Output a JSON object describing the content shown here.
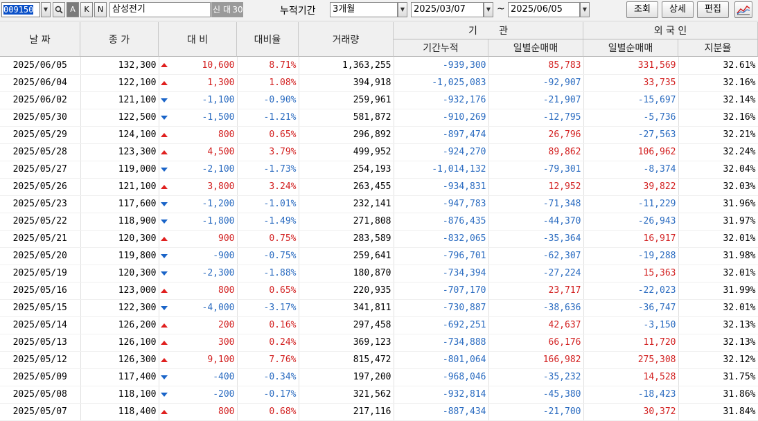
{
  "toolbar": {
    "code": "009150",
    "btn_a": "A",
    "btn_k": "K",
    "btn_n": "N",
    "stock_name": "삼성전기",
    "tag_new": "신",
    "tag_loan": "대",
    "tag_30": "30",
    "period_label": "누적기간",
    "period_value": "3개월",
    "date_from": "2025/03/07",
    "tilde": "~",
    "date_to": "2025/06/05",
    "btn_query": "조회",
    "btn_detail": "상세",
    "btn_edit": "편집"
  },
  "headers": {
    "date": "날 짜",
    "close": "종 가",
    "change": "대 비",
    "change_rate": "대비율",
    "volume": "거래량",
    "inst": "기       관",
    "inst_cum": "기간누적",
    "inst_daily": "일별순매매",
    "foreign": "외 국 인",
    "foreign_daily": "일별순매매",
    "foreign_share": "지분율"
  },
  "colors": {
    "up": "#d21f1f",
    "down": "#2a6bc0"
  },
  "rows": [
    {
      "date": "2025/06/05",
      "close": "132,300",
      "dir": "up",
      "change": "10,600",
      "rate": "8.71%",
      "volume": "1,363,255",
      "inst_cum": "-939,300",
      "inst_daily": "85,783",
      "for_daily": "331,569",
      "share": "32.61%"
    },
    {
      "date": "2025/06/04",
      "close": "122,100",
      "dir": "up",
      "change": "1,300",
      "rate": "1.08%",
      "volume": "394,918",
      "inst_cum": "-1,025,083",
      "inst_daily": "-92,907",
      "for_daily": "33,735",
      "share": "32.16%"
    },
    {
      "date": "2025/06/02",
      "close": "121,100",
      "dir": "down",
      "change": "-1,100",
      "rate": "-0.90%",
      "volume": "259,961",
      "inst_cum": "-932,176",
      "inst_daily": "-21,907",
      "for_daily": "-15,697",
      "share": "32.14%"
    },
    {
      "date": "2025/05/30",
      "close": "122,500",
      "dir": "down",
      "change": "-1,500",
      "rate": "-1.21%",
      "volume": "581,872",
      "inst_cum": "-910,269",
      "inst_daily": "-12,795",
      "for_daily": "-5,736",
      "share": "32.16%"
    },
    {
      "date": "2025/05/29",
      "close": "124,100",
      "dir": "up",
      "change": "800",
      "rate": "0.65%",
      "volume": "296,892",
      "inst_cum": "-897,474",
      "inst_daily": "26,796",
      "for_daily": "-27,563",
      "share": "32.21%"
    },
    {
      "date": "2025/05/28",
      "close": "123,300",
      "dir": "up",
      "change": "4,500",
      "rate": "3.79%",
      "volume": "499,952",
      "inst_cum": "-924,270",
      "inst_daily": "89,862",
      "for_daily": "106,962",
      "share": "32.24%"
    },
    {
      "date": "2025/05/27",
      "close": "119,000",
      "dir": "down",
      "change": "-2,100",
      "rate": "-1.73%",
      "volume": "254,193",
      "inst_cum": "-1,014,132",
      "inst_daily": "-79,301",
      "for_daily": "-8,374",
      "share": "32.04%"
    },
    {
      "date": "2025/05/26",
      "close": "121,100",
      "dir": "up",
      "change": "3,800",
      "rate": "3.24%",
      "volume": "263,455",
      "inst_cum": "-934,831",
      "inst_daily": "12,952",
      "for_daily": "39,822",
      "share": "32.03%"
    },
    {
      "date": "2025/05/23",
      "close": "117,600",
      "dir": "down",
      "change": "-1,200",
      "rate": "-1.01%",
      "volume": "232,141",
      "inst_cum": "-947,783",
      "inst_daily": "-71,348",
      "for_daily": "-11,229",
      "share": "31.96%"
    },
    {
      "date": "2025/05/22",
      "close": "118,900",
      "dir": "down",
      "change": "-1,800",
      "rate": "-1.49%",
      "volume": "271,808",
      "inst_cum": "-876,435",
      "inst_daily": "-44,370",
      "for_daily": "-26,943",
      "share": "31.97%"
    },
    {
      "date": "2025/05/21",
      "close": "120,300",
      "dir": "up",
      "change": "900",
      "rate": "0.75%",
      "volume": "283,589",
      "inst_cum": "-832,065",
      "inst_daily": "-35,364",
      "for_daily": "16,917",
      "share": "32.01%"
    },
    {
      "date": "2025/05/20",
      "close": "119,800",
      "dir": "down",
      "change": "-900",
      "rate": "-0.75%",
      "volume": "259,641",
      "inst_cum": "-796,701",
      "inst_daily": "-62,307",
      "for_daily": "-19,288",
      "share": "31.98%"
    },
    {
      "date": "2025/05/19",
      "close": "120,300",
      "dir": "down",
      "change": "-2,300",
      "rate": "-1.88%",
      "volume": "180,870",
      "inst_cum": "-734,394",
      "inst_daily": "-27,224",
      "for_daily": "15,363",
      "share": "32.01%"
    },
    {
      "date": "2025/05/16",
      "close": "123,000",
      "dir": "up",
      "change": "800",
      "rate": "0.65%",
      "volume": "220,935",
      "inst_cum": "-707,170",
      "inst_daily": "23,717",
      "for_daily": "-22,023",
      "share": "31.99%"
    },
    {
      "date": "2025/05/15",
      "close": "122,300",
      "dir": "down",
      "change": "-4,000",
      "rate": "-3.17%",
      "volume": "341,811",
      "inst_cum": "-730,887",
      "inst_daily": "-38,636",
      "for_daily": "-36,747",
      "share": "32.01%"
    },
    {
      "date": "2025/05/14",
      "close": "126,200",
      "dir": "up",
      "change": "200",
      "rate": "0.16%",
      "volume": "297,458",
      "inst_cum": "-692,251",
      "inst_daily": "42,637",
      "for_daily": "-3,150",
      "share": "32.13%"
    },
    {
      "date": "2025/05/13",
      "close": "126,100",
      "dir": "up",
      "change": "300",
      "rate": "0.24%",
      "volume": "369,123",
      "inst_cum": "-734,888",
      "inst_daily": "66,176",
      "for_daily": "11,720",
      "share": "32.13%"
    },
    {
      "date": "2025/05/12",
      "close": "126,300",
      "dir": "up",
      "change": "9,100",
      "rate": "7.76%",
      "volume": "815,472",
      "inst_cum": "-801,064",
      "inst_daily": "166,982",
      "for_daily": "275,308",
      "share": "32.12%"
    },
    {
      "date": "2025/05/09",
      "close": "117,400",
      "dir": "down",
      "change": "-400",
      "rate": "-0.34%",
      "volume": "197,200",
      "inst_cum": "-968,046",
      "inst_daily": "-35,232",
      "for_daily": "14,528",
      "share": "31.75%"
    },
    {
      "date": "2025/05/08",
      "close": "118,100",
      "dir": "down",
      "change": "-200",
      "rate": "-0.17%",
      "volume": "321,562",
      "inst_cum": "-932,814",
      "inst_daily": "-45,380",
      "for_daily": "-18,423",
      "share": "31.86%"
    },
    {
      "date": "2025/05/07",
      "close": "118,400",
      "dir": "up",
      "change": "800",
      "rate": "0.68%",
      "volume": "217,116",
      "inst_cum": "-887,434",
      "inst_daily": "-21,700",
      "for_daily": "30,372",
      "share": "31.84%"
    }
  ]
}
